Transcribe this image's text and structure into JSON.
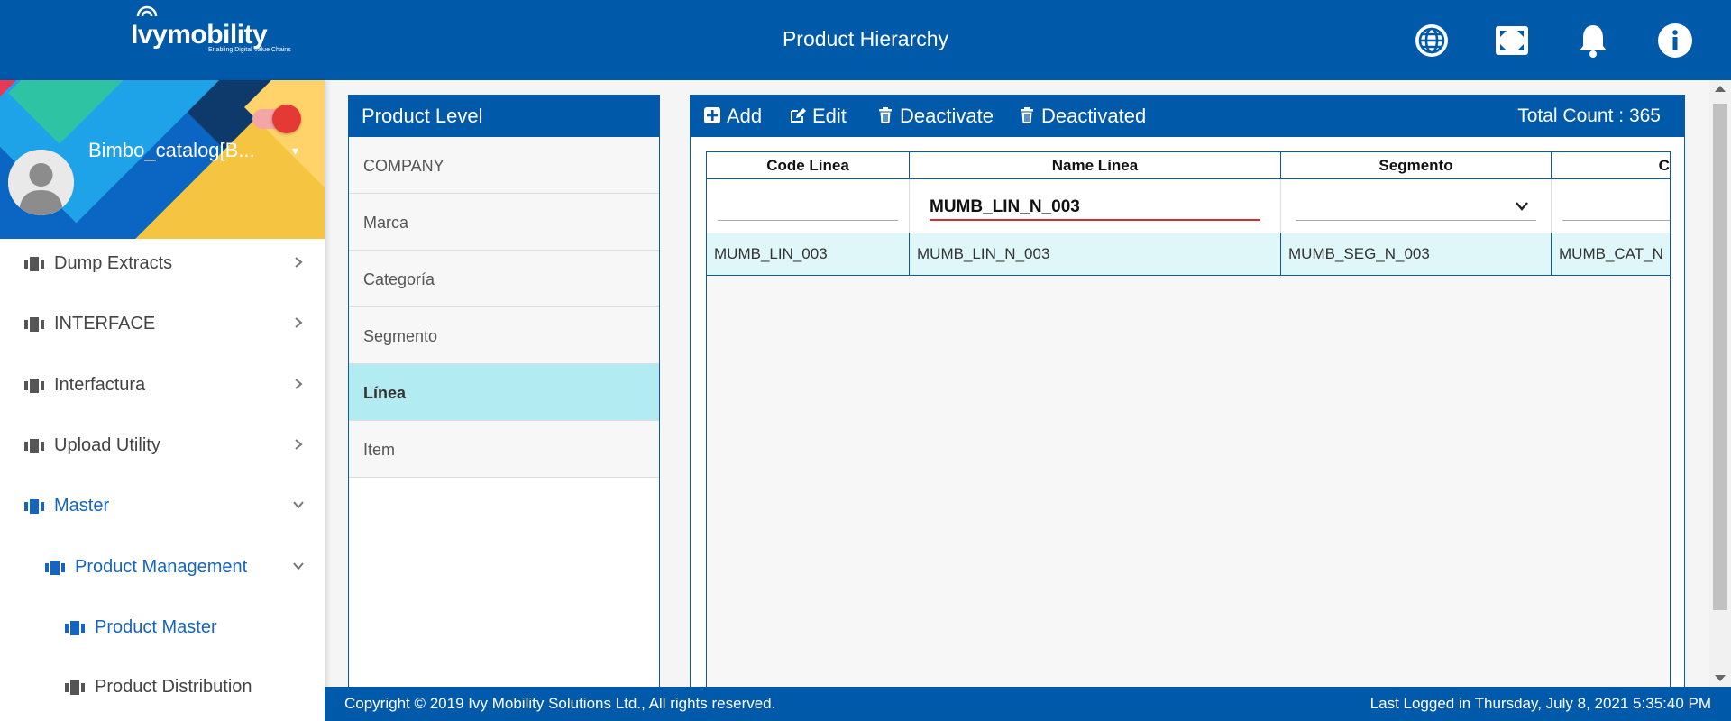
{
  "app": {
    "logo_text": "Ivymobility",
    "logo_tagline": "Enabling Digital Value Chains",
    "page_title": "Product Hierarchy",
    "colors": {
      "primary": "#005aa9",
      "selected_row": "#b2ebf2",
      "grid_row": "#e0f7fa",
      "filter_underline": "#d32f2f"
    },
    "icons": [
      "globe-icon",
      "fullscreen-icon",
      "bell-icon",
      "info-icon"
    ]
  },
  "profile": {
    "name": "Bimbo_catalog[B..."
  },
  "sidebar": {
    "items": [
      {
        "label": "Dump Extracts",
        "expanded": false
      },
      {
        "label": "INTERFACE",
        "expanded": false
      },
      {
        "label": "Interfactura",
        "expanded": false
      },
      {
        "label": "Upload Utility",
        "expanded": false
      },
      {
        "label": "Master",
        "expanded": true
      },
      {
        "label": "Product Management",
        "expanded": true
      },
      {
        "label": "Product Master"
      },
      {
        "label": "Product Distribution"
      }
    ]
  },
  "product_level": {
    "title": "Product Level",
    "items": [
      "COMPANY",
      "Marca",
      "Categoría",
      "Segmento",
      "Línea",
      "Item"
    ],
    "selected": "Línea"
  },
  "toolbar": {
    "add": "Add",
    "edit": "Edit",
    "deactivate": "Deactivate",
    "deactivated": "Deactivated",
    "total_count": "Total Count : 365"
  },
  "grid": {
    "columns": [
      "Code Línea",
      "Name Línea",
      "Segmento",
      "Ca"
    ],
    "filters": {
      "name_linea": "MUMB_LIN_N_003"
    },
    "rows": [
      [
        "MUMB_LIN_003",
        "MUMB_LIN_N_003",
        "MUMB_SEG_N_003",
        "MUMB_CAT_N"
      ]
    ]
  },
  "footer": {
    "copyright": "Copyright © 2019 Ivy Mobility Solutions Ltd., All rights reserved.",
    "last_logged": "Last Logged in Thursday, July 8, 2021 5:35:40 PM"
  }
}
